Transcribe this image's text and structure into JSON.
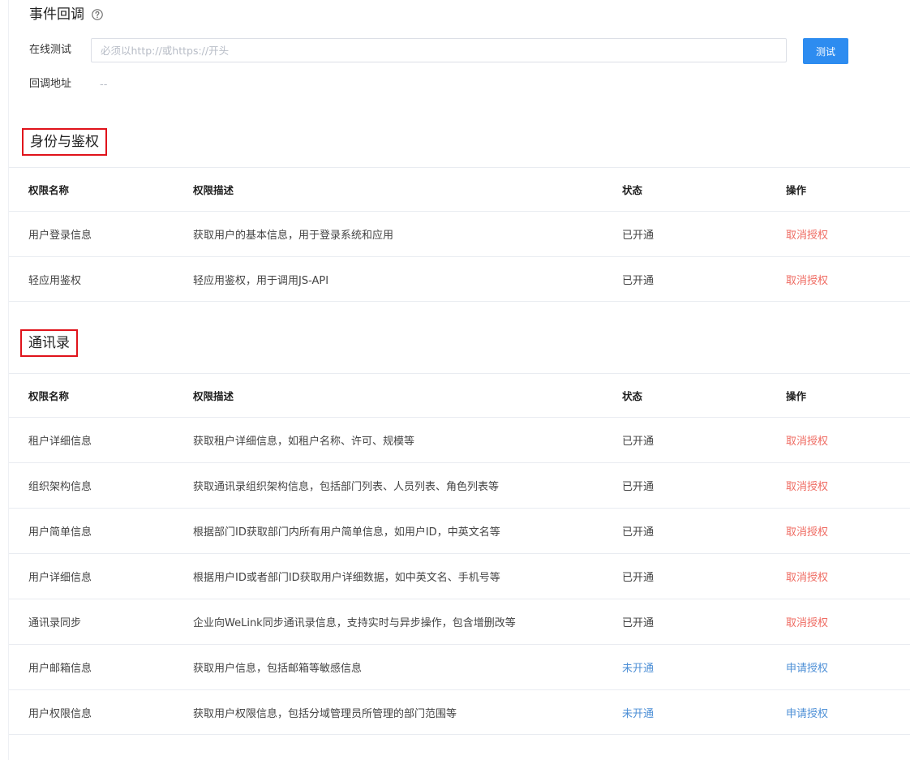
{
  "callback": {
    "title": "事件回调",
    "online_test_label": "在线测试",
    "input_placeholder": "必须以http://或https://开头",
    "input_value": "",
    "test_button": "测试",
    "callback_url_label": "回调地址",
    "callback_url_value": "--"
  },
  "table_headers": {
    "name": "权限名称",
    "description": "权限描述",
    "status": "状态",
    "action": "操作"
  },
  "sections": [
    {
      "title": "身份与鉴权",
      "rows": [
        {
          "name": "用户登录信息",
          "description": "获取用户的基本信息，用于登录系统和应用",
          "status": "已开通",
          "action": "取消授权",
          "enabled": true
        },
        {
          "name": "轻应用鉴权",
          "description": "轻应用鉴权，用于调用JS-API",
          "status": "已开通",
          "action": "取消授权",
          "enabled": true
        }
      ]
    },
    {
      "title": "通讯录",
      "rows": [
        {
          "name": "租户详细信息",
          "description": "获取租户详细信息，如租户名称、许可、规模等",
          "status": "已开通",
          "action": "取消授权",
          "enabled": true
        },
        {
          "name": "组织架构信息",
          "description": "获取通讯录组织架构信息，包括部门列表、人员列表、角色列表等",
          "status": "已开通",
          "action": "取消授权",
          "enabled": true
        },
        {
          "name": "用户简单信息",
          "description": "根据部门ID获取部门内所有用户简单信息，如用户ID，中英文名等",
          "status": "已开通",
          "action": "取消授权",
          "enabled": true
        },
        {
          "name": "用户详细信息",
          "description": "根据用户ID或者部门ID获取用户详细数据，如中英文名、手机号等",
          "status": "已开通",
          "action": "取消授权",
          "enabled": true
        },
        {
          "name": "通讯录同步",
          "description": "企业向WeLink同步通讯录信息，支持实时与异步操作，包含增删改等",
          "status": "已开通",
          "action": "取消授权",
          "enabled": true
        },
        {
          "name": "用户邮箱信息",
          "description": "获取用户信息，包括邮箱等敏感信息",
          "status": "未开通",
          "action": "申请授权",
          "enabled": false
        },
        {
          "name": "用户权限信息",
          "description": "获取用户权限信息，包括分域管理员所管理的部门范围等",
          "status": "未开通",
          "action": "申请授权",
          "enabled": false
        }
      ]
    }
  ],
  "colors": {
    "primary_button": "#2d8cf0",
    "revoke_action": "#ef6b62",
    "apply_action": "#4d8fd6",
    "not_enabled_status": "#4d8fd6",
    "highlight_box": "#e0131b"
  },
  "icons": {
    "help": "question-circle-icon"
  }
}
